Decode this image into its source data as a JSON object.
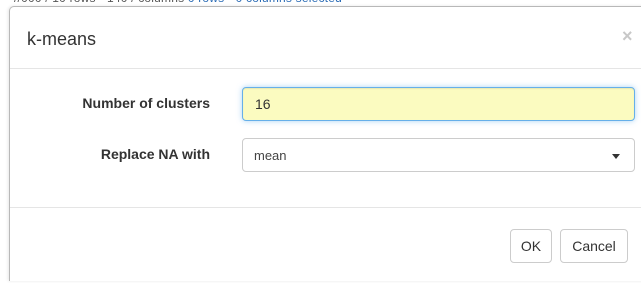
{
  "dialog": {
    "title": "k-means",
    "close_glyph": "×",
    "fields": {
      "clusters": {
        "label": "Number of clusters",
        "value": "16"
      },
      "replace_na": {
        "label": "Replace NA with",
        "selected": "mean"
      }
    },
    "buttons": {
      "ok": "OK",
      "cancel": "Cancel"
    }
  },
  "colors": {
    "input_highlight_bg": "#fbfbc0",
    "focus_border": "#66afe9",
    "close_glyph": "#c8c8c8"
  }
}
